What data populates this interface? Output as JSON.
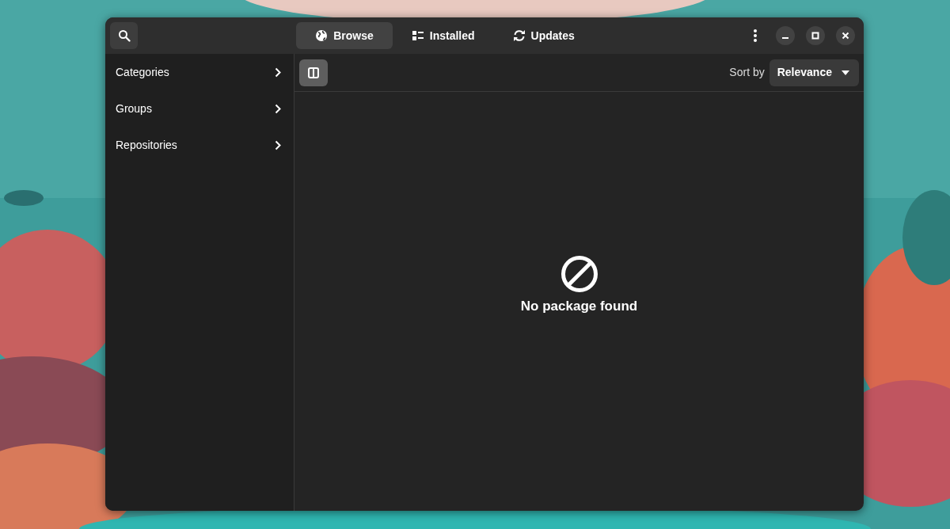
{
  "tabs": [
    {
      "label": "Browse",
      "selected": true
    },
    {
      "label": "Installed",
      "selected": false
    },
    {
      "label": "Updates",
      "selected": false
    }
  ],
  "sidebar": {
    "items": [
      {
        "label": "Categories"
      },
      {
        "label": "Groups"
      },
      {
        "label": "Repositories"
      }
    ]
  },
  "toolbar": {
    "sidebar_toggle": {
      "active": true
    },
    "sort_label": "Sort by",
    "sort_value": "Relevance"
  },
  "empty_state": {
    "message": "No package found"
  }
}
